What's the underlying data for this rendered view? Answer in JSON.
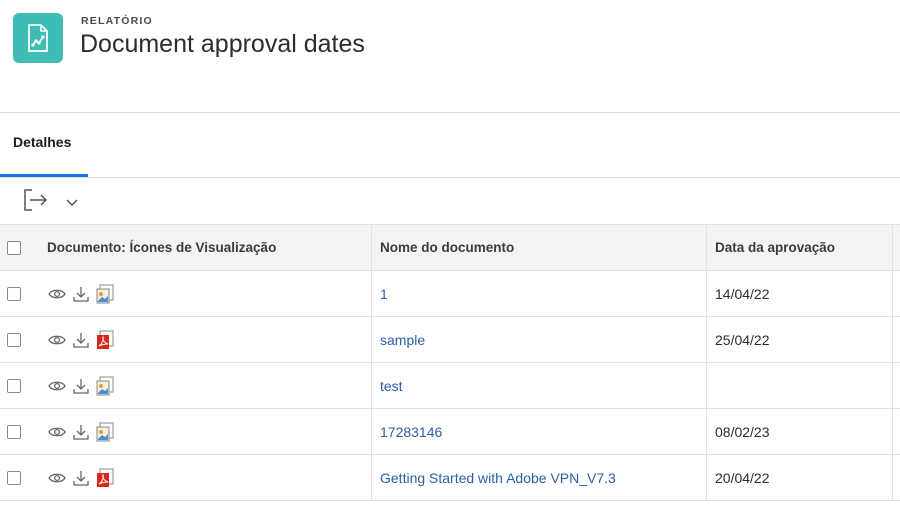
{
  "header": {
    "kicker": "RELATÓRIO",
    "title": "Document approval dates",
    "icon": "report-chart-icon",
    "icon_color": "#3fbdb5"
  },
  "tabs": [
    {
      "label": "Detalhes",
      "active": true
    }
  ],
  "accent": "#1473e6",
  "link_color": "#2a5ea8",
  "toolbar": {
    "export_icon": "export-icon",
    "menu_icon": "chevron-down-icon"
  },
  "table": {
    "columns": [
      "Documento: Ícones de Visualização",
      "Nome do documento",
      "Data da aprovação"
    ],
    "rows": [
      {
        "name": "1",
        "date": "14/04/22",
        "file_type": "image"
      },
      {
        "name": "sample",
        "date": "25/04/22",
        "file_type": "pdf"
      },
      {
        "name": "test",
        "date": "",
        "file_type": "image"
      },
      {
        "name": "17283146",
        "date": "08/02/23",
        "file_type": "image"
      },
      {
        "name": "Getting Started with Adobe VPN_V7.3",
        "date": "20/04/22",
        "file_type": "pdf"
      }
    ]
  }
}
